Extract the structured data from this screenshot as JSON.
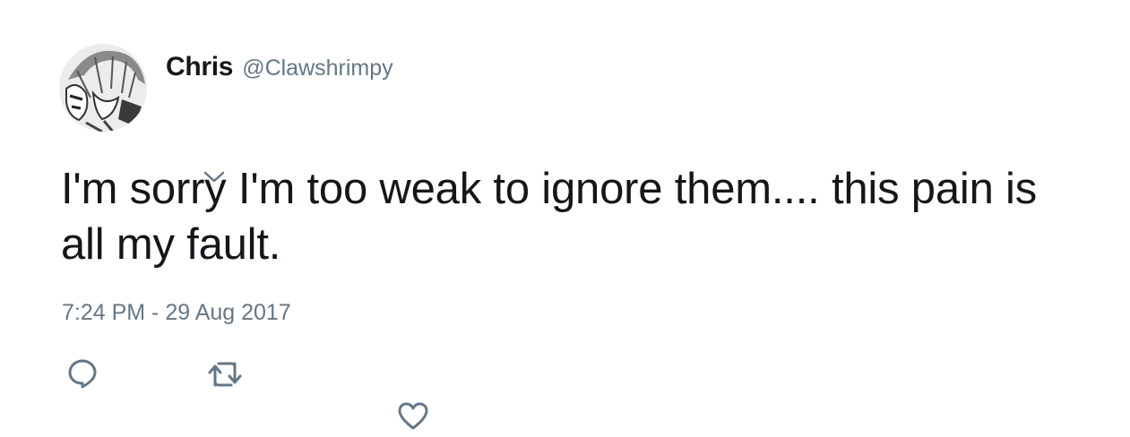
{
  "author": {
    "display_name": "Chris",
    "handle": "@Clawshrimpy",
    "avatar_icon": "anime-avatar-icon"
  },
  "tweet": {
    "text": "I'm sorry I'm too weak to ignore them.... this pain is all my fault.",
    "timestamp": "7:24 PM - 29 Aug 2017"
  },
  "actions": {
    "reply_icon": "reply-icon",
    "retweet_icon": "retweet-icon",
    "like_icon": "heart-icon"
  },
  "colors": {
    "text": "#14171a",
    "secondary": "#657786",
    "background": "#ffffff"
  }
}
